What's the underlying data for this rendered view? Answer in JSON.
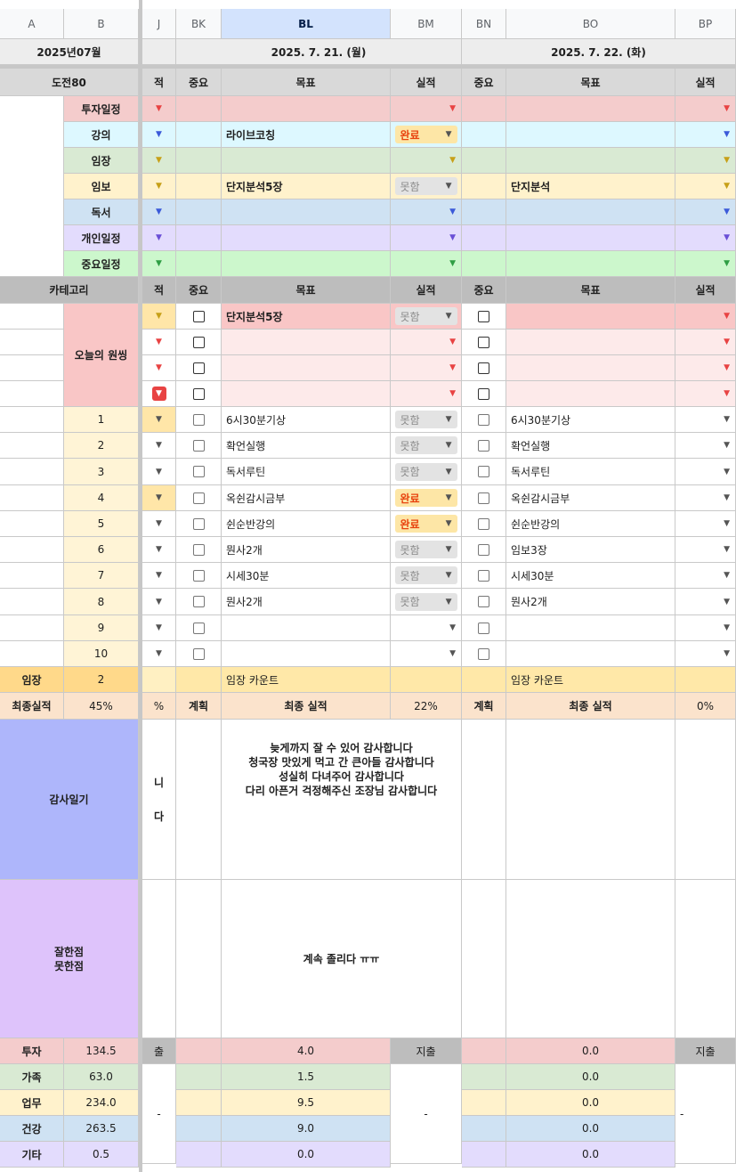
{
  "column_headers": {
    "A": "A",
    "B": "B",
    "BJ": "J",
    "BK": "BK",
    "BL": "BL",
    "BM": "BM",
    "BN": "BN",
    "BO": "BO",
    "BP": "BP"
  },
  "month_label": "2025년07월",
  "date1": "2025. 7. 21. (월)",
  "date2": "2025. 7. 22. (화)",
  "challenge_label": "도전80",
  "sched_header": {
    "partial": "적",
    "importance": "중요",
    "goal": "목표",
    "result": "실적"
  },
  "schedule_rows": [
    {
      "label": "투자일정",
      "d1_goal": "",
      "d1_result": "",
      "d2_goal": ""
    },
    {
      "label": "강의",
      "d1_goal": "라이브코칭",
      "d1_result": "완료",
      "d2_goal": ""
    },
    {
      "label": "임장",
      "d1_goal": "",
      "d1_result": "",
      "d2_goal": ""
    },
    {
      "label": "임보",
      "d1_goal": "단지분석5장",
      "d1_result": "못함",
      "d2_goal": "단지분석"
    },
    {
      "label": "독서",
      "d1_goal": "",
      "d1_result": "",
      "d2_goal": ""
    },
    {
      "label": "개인일정",
      "d1_goal": "",
      "d1_result": "",
      "d2_goal": ""
    },
    {
      "label": "중요일정",
      "d1_goal": "",
      "d1_result": "",
      "d2_goal": ""
    }
  ],
  "category_label": "카테고리",
  "one_thing_label": "오늘의 원씽",
  "one_thing_rows": [
    {
      "d1_goal": "단지분석5장",
      "d1_result": "못함",
      "d2_goal": ""
    },
    {
      "d1_goal": "",
      "d1_result": "",
      "d2_goal": ""
    },
    {
      "d1_goal": "",
      "d1_result": "",
      "d2_goal": ""
    },
    {
      "d1_goal": "",
      "d1_result": "",
      "d2_goal": ""
    }
  ],
  "task_rows": [
    {
      "num": "1",
      "d1_goal": "6시30분기상",
      "d1_result": "못함",
      "d2_goal": "6시30분기상"
    },
    {
      "num": "2",
      "d1_goal": "확언실행",
      "d1_result": "못함",
      "d2_goal": "확언실행"
    },
    {
      "num": "3",
      "d1_goal": "독서루틴",
      "d1_result": "못함",
      "d2_goal": "독서루틴"
    },
    {
      "num": "4",
      "d1_goal": "옥쉰감시금부",
      "d1_result": "완료",
      "d2_goal": "옥쉰감시금부"
    },
    {
      "num": "5",
      "d1_goal": "쉰순반강의",
      "d1_result": "완료",
      "d2_goal": "쉰순반강의"
    },
    {
      "num": "6",
      "d1_goal": "뭔사2개",
      "d1_result": "못함",
      "d2_goal": "임보3장"
    },
    {
      "num": "7",
      "d1_goal": "시세30분",
      "d1_result": "못함",
      "d2_goal": "시세30분"
    },
    {
      "num": "8",
      "d1_goal": "뭔사2개",
      "d1_result": "못함",
      "d2_goal": "뭔사2개"
    },
    {
      "num": "9",
      "d1_goal": "",
      "d1_result": "",
      "d2_goal": ""
    },
    {
      "num": "10",
      "d1_goal": "",
      "d1_result": "",
      "d2_goal": ""
    }
  ],
  "imjang_label": "임장",
  "imjang_value": "2",
  "imjang_count_label": "임장 카운트",
  "final_label": "최종실적",
  "final_value": "45%",
  "final_partial": "%",
  "plan_label": "계획",
  "final_result_label": "최종 실적",
  "d1_final": "22%",
  "d2_final": "0%",
  "gratitude_label": "감사일기",
  "gratitude_partial": [
    "니",
    "다"
  ],
  "gratitude_text": [
    "늦게까지 잘 수 있어 감사합니다",
    "청국장 맛있게 먹고 간 큰아들 감사합니다",
    "성실히 다녀주어 감사합니다",
    "다리 아픈거 걱정해주신 조장님 감사합니다"
  ],
  "review_label": [
    "잘한점",
    "못한점"
  ],
  "review_text": "계속 졸리다 ㅠㅠ",
  "summary": [
    {
      "label": "투자",
      "total": "134.5",
      "d1": "4.0",
      "d2": "0.0"
    },
    {
      "label": "가족",
      "total": "63.0",
      "d1": "1.5",
      "d2": "0.0"
    },
    {
      "label": "업무",
      "total": "234.0",
      "d1": "9.5",
      "d2": "0.0"
    },
    {
      "label": "건강",
      "total": "263.5",
      "d1": "9.0",
      "d2": "0.0"
    },
    {
      "label": "기타",
      "total": "0.5",
      "d1": "0.0",
      "d2": "0.0"
    }
  ],
  "expense_label": "지출",
  "expense_partial": "출",
  "dash": "-",
  "colors": {
    "invest": "#f4cccc",
    "lecture": "#ddf8ff",
    "imjang": "#d9ead3",
    "imbo": "#fff2cc",
    "reading": "#cfe2f3",
    "personal": "#e3dcfd",
    "important": "#ccf7cc",
    "onething": "#f9c6c6",
    "onething_light": "#fdeaea",
    "num_bg": "#fff4d6",
    "orange_bg": "#ffe6a8",
    "peach": "#fbe3cc",
    "gratitude": "#aeb6fb",
    "review": "#dec3fb"
  }
}
